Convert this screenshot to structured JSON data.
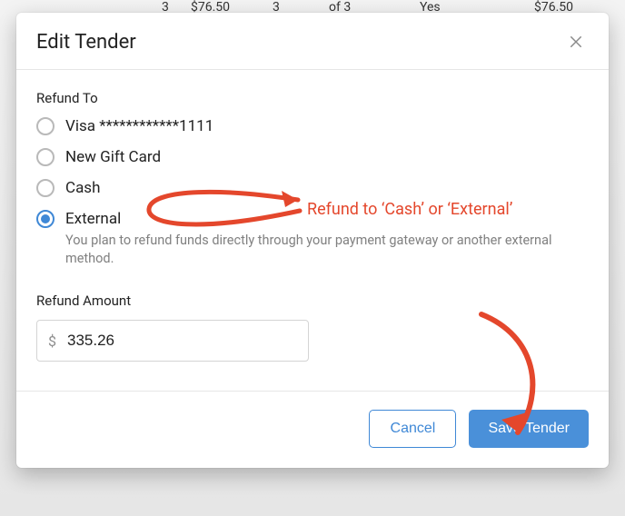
{
  "dialog": {
    "title": "Edit Tender",
    "refund_to_label": "Refund To",
    "options": [
      {
        "label": "Visa ************1111"
      },
      {
        "label": "New Gift Card"
      },
      {
        "label": "Cash"
      },
      {
        "label": "External"
      }
    ],
    "selected_index": 3,
    "external_helper": "You plan to refund funds directly through your payment gateway or another external method.",
    "refund_amount_label": "Refund Amount",
    "currency_symbol": "$",
    "amount_value": "335.26",
    "cancel_label": "Cancel",
    "save_label": "Save Tender"
  },
  "annotations": {
    "callout_text": "Refund to ‘Cash’ or ‘External’",
    "accent_color": "#e4472c"
  },
  "background_peek": {
    "qty1": "3",
    "price1": "$76.50",
    "qty2": "3",
    "of": "of 3",
    "yes": "Yes",
    "price2": "$76.50"
  }
}
